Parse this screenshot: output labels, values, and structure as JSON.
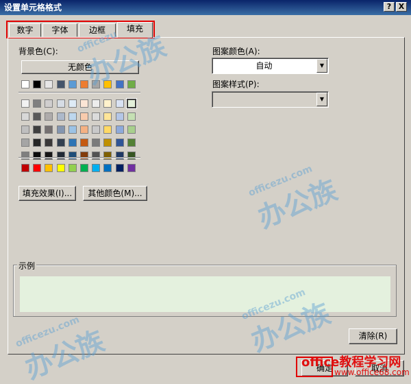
{
  "window": {
    "title": "设置单元格格式",
    "help_btn": "?",
    "close_btn": "X"
  },
  "tabs": [
    {
      "label": "数字"
    },
    {
      "label": "字体"
    },
    {
      "label": "边框"
    },
    {
      "label": "填充"
    }
  ],
  "fill": {
    "bg_label": "背景色(C):",
    "no_color": "无颜色",
    "fill_effects": "填充效果(I)...",
    "more_colors": "其他颜色(M)...",
    "pattern_color_label": "图案颜色(A):",
    "pattern_color_value": "自动",
    "pattern_style_label": "图案样式(P):",
    "pattern_style_value": "",
    "sample_label": "示例",
    "clear": "清除(R)"
  },
  "footer": {
    "ok": "确定",
    "cancel": "取消"
  },
  "palette": {
    "theme_top": [
      "#ffffff",
      "#000000",
      "#e7e6e6",
      "#44546a",
      "#5b9bd5",
      "#ed7d31",
      "#a5a5a5",
      "#ffc000",
      "#4472c4",
      "#70ad47"
    ],
    "theme_grid": [
      [
        "#f2f2f2",
        "#7f7f7f",
        "#d0cece",
        "#d6dce4",
        "#deebf6",
        "#fbe5d5",
        "#ededed",
        "#fff2cc",
        "#d9e2f3",
        "#e2efd9"
      ],
      [
        "#d8d8d8",
        "#595959",
        "#aeabab",
        "#adb9ca",
        "#bdd7ee",
        "#f8cbad",
        "#dbdbdb",
        "#fee599",
        "#b4c6e7",
        "#c5e0b3"
      ],
      [
        "#bfbfbf",
        "#3f3f3f",
        "#757070",
        "#8496b0",
        "#9cc3e5",
        "#f4b183",
        "#c9c9c9",
        "#ffd965",
        "#8eaadb",
        "#a8d08d"
      ],
      [
        "#a5a5a5",
        "#262626",
        "#3a3838",
        "#323f4f",
        "#2e75b5",
        "#c55a11",
        "#7b7b7b",
        "#bf9000",
        "#2f5496",
        "#538135"
      ],
      [
        "#7f7f7f",
        "#0c0c0c",
        "#171616",
        "#222a35",
        "#1f4e79",
        "#833c0b",
        "#525252",
        "#7f6000",
        "#1f3864",
        "#375623"
      ]
    ],
    "standard": [
      "#c00000",
      "#ff0000",
      "#ffc000",
      "#ffff00",
      "#92d050",
      "#00b050",
      "#00b0f0",
      "#0070c0",
      "#002060",
      "#7030a0"
    ]
  },
  "watermark": {
    "text": "办公族",
    "small": "officezu.com"
  },
  "brand": {
    "line1": "office教程学习网",
    "line2": "www.office68.com"
  },
  "colors": {
    "selected_swatch": "#e2efd9",
    "preview": "#e4f1de"
  }
}
